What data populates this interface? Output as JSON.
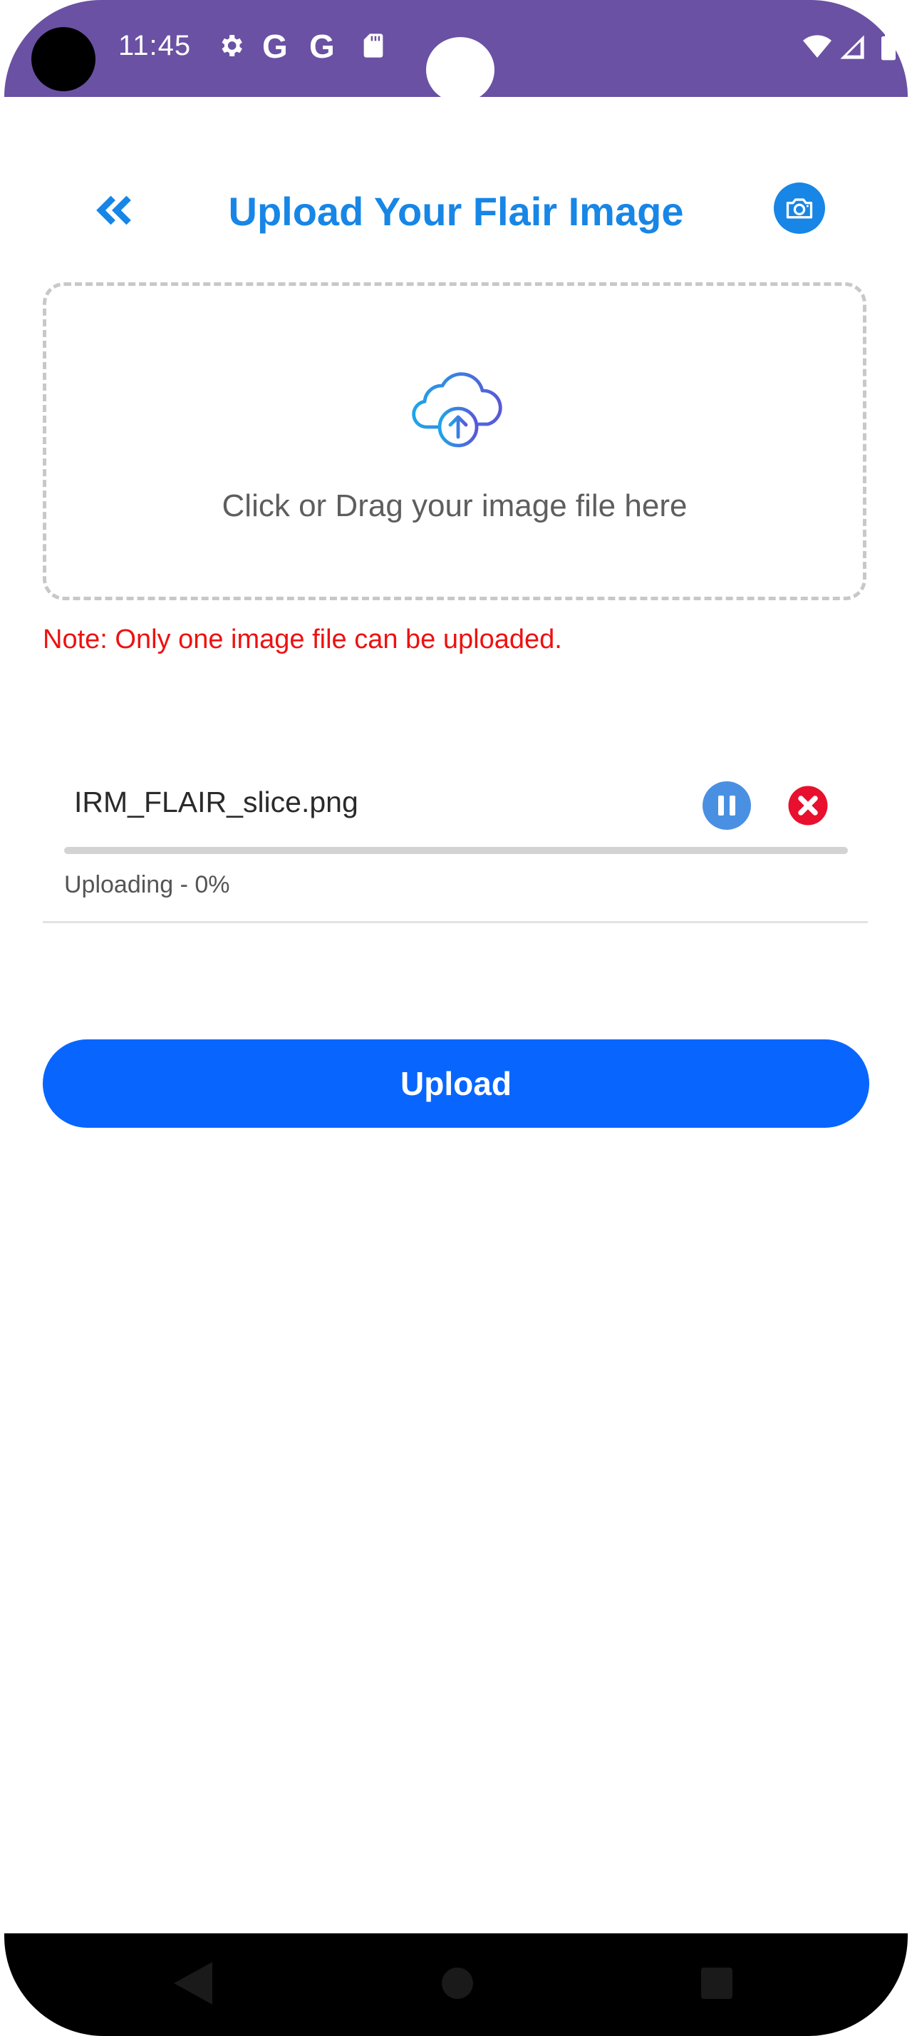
{
  "status_bar": {
    "time": "11:45",
    "icons": [
      "settings-icon",
      "google-icon",
      "google-icon",
      "sd-card-icon",
      "wifi-icon",
      "signal-icon",
      "battery-icon"
    ],
    "background_color": "#6a51a3"
  },
  "header": {
    "title": "Upload Your Flair Image",
    "back_icon": "double-chevron-left-icon",
    "camera_icon": "camera-icon",
    "accent_color": "#1786e6"
  },
  "dropzone": {
    "icon": "cloud-upload-icon",
    "text": "Click or Drag your image file here"
  },
  "note": {
    "text": "Note: Only one image file can be uploaded.",
    "color": "#ee1111"
  },
  "file": {
    "name": "IRM_FLAIR_slice.png",
    "status": "Uploading - 0%",
    "progress": 0,
    "pause_icon": "pause-icon",
    "cancel_icon": "cancel-icon"
  },
  "actions": {
    "upload_label": "Upload",
    "upload_color": "#0866ff"
  },
  "nav_bar": {
    "icons": [
      "back-icon",
      "home-icon",
      "recents-icon"
    ]
  }
}
